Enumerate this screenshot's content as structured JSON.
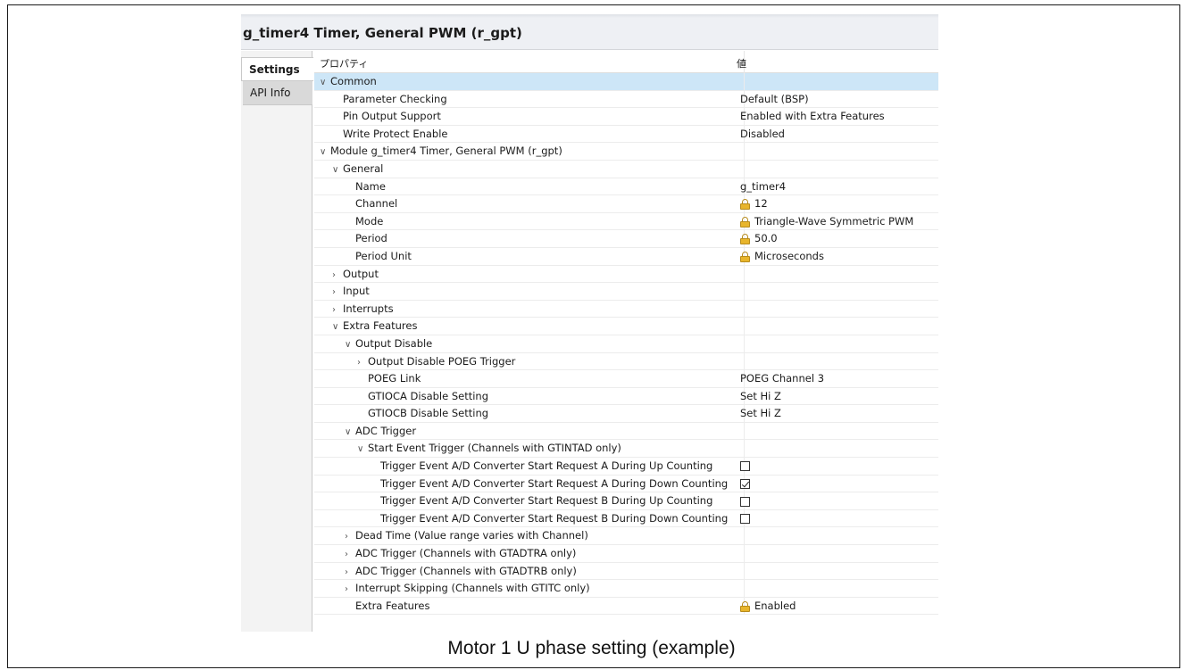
{
  "panel": {
    "title": "g_timer4 Timer, General PWM (r_gpt)"
  },
  "tabs": [
    {
      "label": "Settings",
      "active": true
    },
    {
      "label": "API Info",
      "active": false
    }
  ],
  "table": {
    "col_property": "プロパティ",
    "col_value": "値",
    "rows": [
      {
        "indent": 0,
        "chev": "down",
        "label": "Common",
        "value": "",
        "selected": true
      },
      {
        "indent": 1,
        "chev": "",
        "label": "Parameter Checking",
        "value": "Default (BSP)"
      },
      {
        "indent": 1,
        "chev": "",
        "label": "Pin Output Support",
        "value": "Enabled with Extra Features"
      },
      {
        "indent": 1,
        "chev": "",
        "label": "Write Protect Enable",
        "value": "Disabled"
      },
      {
        "indent": 0,
        "chev": "down",
        "label": "Module g_timer4 Timer, General PWM (r_gpt)",
        "value": ""
      },
      {
        "indent": 1,
        "chev": "down",
        "label": "General",
        "value": ""
      },
      {
        "indent": 2,
        "chev": "",
        "label": "Name",
        "value": "g_timer4"
      },
      {
        "indent": 2,
        "chev": "",
        "label": "Channel",
        "value": "12",
        "lock": true
      },
      {
        "indent": 2,
        "chev": "",
        "label": "Mode",
        "value": "Triangle-Wave Symmetric PWM",
        "lock": true
      },
      {
        "indent": 2,
        "chev": "",
        "label": "Period",
        "value": "50.0",
        "lock": true
      },
      {
        "indent": 2,
        "chev": "",
        "label": "Period Unit",
        "value": "Microseconds",
        "lock": true
      },
      {
        "indent": 1,
        "chev": "right",
        "label": "Output",
        "value": ""
      },
      {
        "indent": 1,
        "chev": "right",
        "label": "Input",
        "value": ""
      },
      {
        "indent": 1,
        "chev": "right",
        "label": "Interrupts",
        "value": ""
      },
      {
        "indent": 1,
        "chev": "down",
        "label": "Extra Features",
        "value": ""
      },
      {
        "indent": 2,
        "chev": "down",
        "label": "Output Disable",
        "value": ""
      },
      {
        "indent": 3,
        "chev": "right",
        "label": "Output Disable POEG Trigger",
        "value": ""
      },
      {
        "indent": 3,
        "chev": "",
        "label": "POEG Link",
        "value": "POEG Channel 3"
      },
      {
        "indent": 3,
        "chev": "",
        "label": "GTIOCA Disable Setting",
        "value": "Set Hi Z"
      },
      {
        "indent": 3,
        "chev": "",
        "label": "GTIOCB Disable Setting",
        "value": "Set Hi Z"
      },
      {
        "indent": 2,
        "chev": "down",
        "label": "ADC Trigger",
        "value": ""
      },
      {
        "indent": 3,
        "chev": "down",
        "label": "Start Event Trigger (Channels with GTINTAD only)",
        "value": ""
      },
      {
        "indent": 4,
        "chev": "",
        "label": "Trigger Event A/D Converter Start Request A During Up Counting",
        "value": "",
        "checkbox": false
      },
      {
        "indent": 4,
        "chev": "",
        "label": "Trigger Event A/D Converter Start Request A During Down Counting",
        "value": "",
        "checkbox": true
      },
      {
        "indent": 4,
        "chev": "",
        "label": "Trigger Event A/D Converter Start Request B During Up Counting",
        "value": "",
        "checkbox": false
      },
      {
        "indent": 4,
        "chev": "",
        "label": "Trigger Event A/D Converter Start Request B During Down Counting",
        "value": "",
        "checkbox": false
      },
      {
        "indent": 2,
        "chev": "right",
        "label": "Dead Time (Value range varies with Channel)",
        "value": ""
      },
      {
        "indent": 2,
        "chev": "right",
        "label": "ADC Trigger (Channels with GTADTRA only)",
        "value": ""
      },
      {
        "indent": 2,
        "chev": "right",
        "label": "ADC Trigger (Channels with GTADTRB only)",
        "value": ""
      },
      {
        "indent": 2,
        "chev": "right",
        "label": "Interrupt Skipping (Channels with GTITC only)",
        "value": ""
      },
      {
        "indent": 2,
        "chev": "",
        "label": "Extra Features",
        "value": "Enabled",
        "lock": true
      }
    ]
  },
  "caption": "Motor 1 U phase setting (example)"
}
